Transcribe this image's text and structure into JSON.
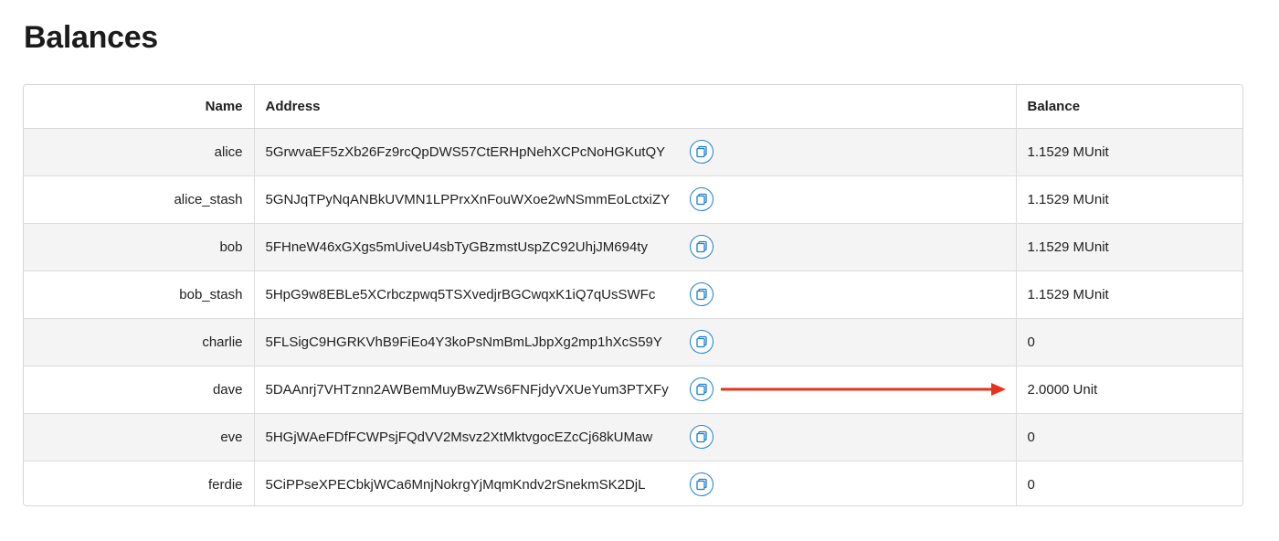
{
  "page": {
    "title": "Balances"
  },
  "table": {
    "headers": {
      "name": "Name",
      "address": "Address",
      "balance": "Balance"
    },
    "rows": [
      {
        "name": "alice",
        "address": "5GrwvaEF5zXb26Fz9rcQpDWS57CtERHpNehXCPcNoHGKutQY",
        "balance": "1.1529 MUnit"
      },
      {
        "name": "alice_stash",
        "address": "5GNJqTPyNqANBkUVMN1LPPrxXnFouWXoe2wNSmmEoLctxiZY",
        "balance": "1.1529 MUnit"
      },
      {
        "name": "bob",
        "address": "5FHneW46xGXgs5mUiveU4sbTyGBzmstUspZC92UhjJM694ty",
        "balance": "1.1529 MUnit"
      },
      {
        "name": "bob_stash",
        "address": "5HpG9w8EBLe5XCrbczpwq5TSXvedjrBGCwqxK1iQ7qUsSWFc",
        "balance": "1.1529 MUnit"
      },
      {
        "name": "charlie",
        "address": "5FLSigC9HGRKVhB9FiEo4Y3koPsNmBmLJbpXg2mp1hXcS59Y",
        "balance": "0"
      },
      {
        "name": "dave",
        "address": "5DAAnrj7VHTznn2AWBemMuyBwZWs6FNFjdyVXUeYum3PTXFy",
        "balance": "2.0000 Unit"
      },
      {
        "name": "eve",
        "address": "5HGjWAeFDfFCWPsjFQdVV2Msvz2XtMktvgocEZcCj68kUMaw",
        "balance": "0"
      },
      {
        "name": "ferdie",
        "address": "5CiPPseXPECbkjWCa6MnjNokrgYjMqmKndv2rSnekmSK2DjL",
        "balance": "0"
      }
    ],
    "copy_icon": "copy-icon"
  },
  "annotation": {
    "arrow_color": "#e8321f",
    "accent_color": "#1d7fd3"
  }
}
